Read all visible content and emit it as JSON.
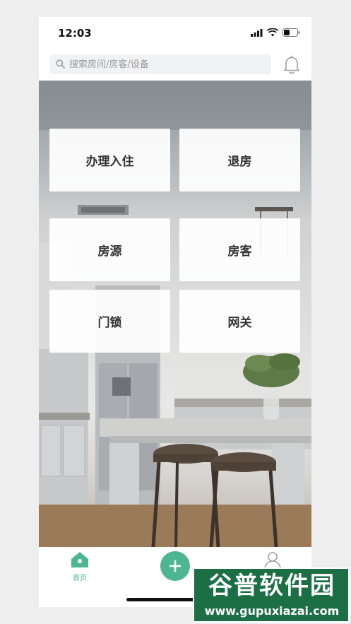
{
  "status_bar": {
    "time": "12:03",
    "icons": [
      "signal-icon",
      "wifi-icon",
      "battery-icon"
    ]
  },
  "search": {
    "placeholder": "搜索房间/房客/设备",
    "icon": "search-icon"
  },
  "header": {
    "notification_icon": "bell-icon"
  },
  "grid": {
    "tiles": [
      {
        "label": "办理入住"
      },
      {
        "label": "退房"
      },
      {
        "label": "房源"
      },
      {
        "label": "房客"
      },
      {
        "label": "门锁"
      },
      {
        "label": "网关"
      }
    ]
  },
  "tab_bar": {
    "home_label": "首页",
    "home_icon": "home-icon",
    "add_icon": "plus-icon",
    "profile_icon": "user-icon"
  },
  "watermark": {
    "text": "谷普软件园",
    "url": "www.gupuxiazai.com"
  },
  "colors": {
    "accent": "#4eb591",
    "tile_bg": "#ffffff",
    "page_bg": "#eeeeee",
    "watermark_bg": "#1c6f45"
  }
}
